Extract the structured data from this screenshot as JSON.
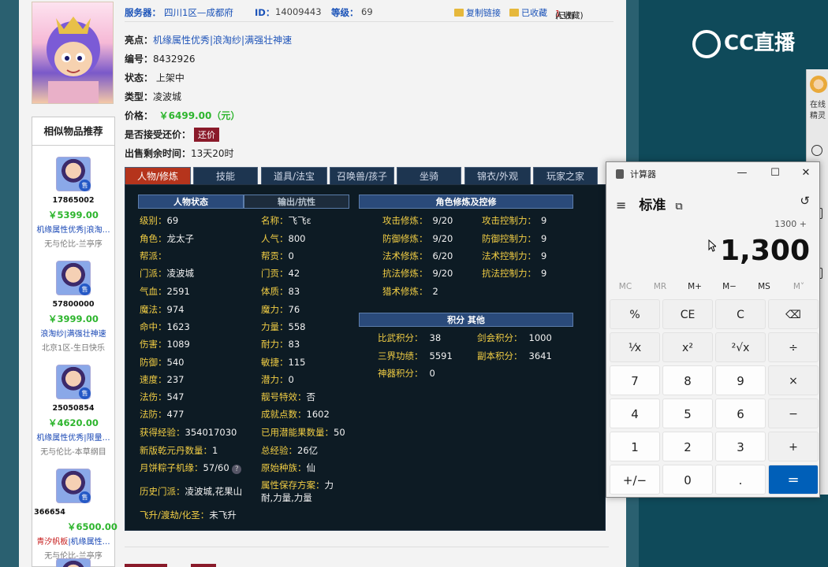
{
  "header": {
    "server_label": "服务器：",
    "server_value": "四川1区—成都府",
    "id_label": "ID：",
    "id_value": "14009443",
    "level_label": "等级：",
    "level_value": "69",
    "copy_link": "复制链接",
    "favorited": "已收藏",
    "fav_count_prefix": "(已有",
    "fav_count": "1",
    "fav_count_suffix": "人收藏)"
  },
  "item": {
    "highlight_label": "亮点：",
    "highlight_value": "机缘属性优秀|浪淘纱|满强壮神速",
    "number_label": "编号：",
    "number_value": "8432926",
    "status_label": "状态：",
    "status_value": "上架中",
    "type_label": "类型：",
    "type_value": "凌波城",
    "price_label": "价格：",
    "price_value": "￥6499.00（元）",
    "bargain_label": "是否接受还价：",
    "bargain_button": "还价",
    "time_label": "出售剩余时间：",
    "time_value": "13天20时"
  },
  "sidebar": {
    "title": "相似物品推荐",
    "tag": "售",
    "items": [
      {
        "id": "17865002",
        "price": "￥5399.00",
        "desc": "机缘属性优秀|浪淘…",
        "server": "无与伦比-兰亭序"
      },
      {
        "id": "57800000",
        "price": "￥3999.00",
        "desc": "浪淘纱|满强壮神速",
        "server": "北京1区-生日快乐"
      },
      {
        "id": "25050854",
        "price": "￥4620.00",
        "desc": "机缘属性优秀|限量…",
        "server": "无与伦比-本草纲目"
      },
      {
        "id": "366654",
        "price": "￥6500.00",
        "desc_red": "青汐帆板",
        "desc": "|机缘属性…",
        "server": "无与伦比-兰亭序"
      }
    ]
  },
  "tabs": [
    "人物/修炼",
    "技能",
    "道具/法宝",
    "召唤兽/孩子",
    "坐骑",
    "锦衣/外观",
    "玩家之家"
  ],
  "panel": {
    "sub_status": "人物状态",
    "sub_output": "输出/抗性",
    "sub_cultivation": "角色修炼及控修",
    "sub_points": "积分 其他",
    "col1": [
      {
        "k": "级别：",
        "v": "69"
      },
      {
        "k": "角色：",
        "v": "龙太子"
      },
      {
        "k": "帮派：",
        "v": ""
      },
      {
        "k": "门派：",
        "v": "凌波城"
      },
      {
        "k": "气血：",
        "v": "2591"
      },
      {
        "k": "魔法：",
        "v": "974"
      },
      {
        "k": "命中：",
        "v": "1623"
      },
      {
        "k": "伤害：",
        "v": "1089"
      },
      {
        "k": "防御：",
        "v": "540"
      },
      {
        "k": "速度：",
        "v": "237"
      },
      {
        "k": "法伤：",
        "v": "547"
      },
      {
        "k": "法防：",
        "v": "477"
      }
    ],
    "col2": [
      {
        "k": "名称：",
        "v": "飞飞ε"
      },
      {
        "k": "人气：",
        "v": "800"
      },
      {
        "k": "帮贡：",
        "v": "0"
      },
      {
        "k": "门贡：",
        "v": "42"
      },
      {
        "k": "体质：",
        "v": "83"
      },
      {
        "k": "魔力：",
        "v": "76"
      },
      {
        "k": "力量：",
        "v": "558"
      },
      {
        "k": "耐力：",
        "v": "83"
      },
      {
        "k": "敏捷：",
        "v": "115"
      },
      {
        "k": "潜力：",
        "v": "0"
      },
      {
        "k": "靓号特效：",
        "v": "否"
      },
      {
        "k": "成就点数：",
        "v": "1602"
      }
    ],
    "extra": {
      "exp_k": "获得经验：",
      "exp_v": "354017030",
      "potion_k": "已用潜能果数量：",
      "potion_v": "50",
      "pill_k": "新版乾元丹数量：",
      "pill_v": "1",
      "total_k": "总经验：",
      "total_v": "26亿",
      "zongzi_k": "月饼粽子机缘：",
      "zongzi_v": "57/60",
      "race_k": "原始种族：",
      "race_v": "仙",
      "hist_k": "历史门派：",
      "hist_v": "凌波城,花果山",
      "save_k": "属性保存方案：",
      "save_v1": "力",
      "save_v2": "耐,力量,力量",
      "fly_k": "飞升/渡劫/化圣：",
      "fly_v": "未飞升",
      "help": "?"
    },
    "cult": [
      {
        "k": "攻击修炼：",
        "v": "9/20",
        "k2": "攻击控制力：",
        "v2": "9"
      },
      {
        "k": "防御修炼：",
        "v": "9/20",
        "k2": "防御控制力：",
        "v2": "9"
      },
      {
        "k": "法术修炼：",
        "v": "6/20",
        "k2": "法术控制力：",
        "v2": "9"
      },
      {
        "k": "抗法修炼：",
        "v": "9/20",
        "k2": "抗法控制力：",
        "v2": "9"
      },
      {
        "k": "猎术修炼：",
        "v": "2",
        "k2": "",
        "v2": ""
      }
    ],
    "points": [
      {
        "k": "比武积分：",
        "v": "38",
        "k2": "剑会积分：",
        "v2": "1000"
      },
      {
        "k": "三界功绩：",
        "v": "5591",
        "k2": "副本积分：",
        "v2": "3641"
      },
      {
        "k": "神器积分：",
        "v": "0",
        "k2": "",
        "v2": ""
      }
    ]
  },
  "stream": {
    "logo": "CC直播",
    "strip_text1": "在线",
    "strip_text2": "精灵"
  },
  "calculator": {
    "title": "计算器",
    "mode": "标准",
    "menu_icon": "≡",
    "pin_icon": "⧉",
    "history_icon": "↺",
    "expression": "1300 +",
    "display": "1,300",
    "memory": [
      "MC",
      "MR",
      "M+",
      "M−",
      "MS",
      "M˅"
    ],
    "keys": [
      [
        "%",
        "CE",
        "C",
        "⌫"
      ],
      [
        "¹⁄x",
        "x²",
        "²√x",
        "÷"
      ],
      [
        "7",
        "8",
        "9",
        "×"
      ],
      [
        "4",
        "5",
        "6",
        "−"
      ],
      [
        "1",
        "2",
        "3",
        "+"
      ],
      [
        "+/−",
        "0",
        ".",
        "="
      ]
    ],
    "minimize": "—",
    "maximize": "☐",
    "close": "✕"
  }
}
